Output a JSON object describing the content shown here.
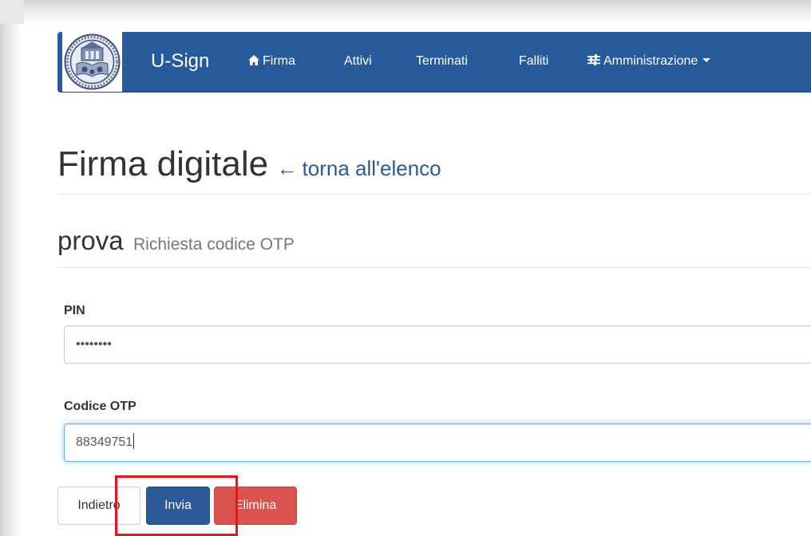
{
  "navbar": {
    "brand": "U-Sign",
    "logo_icon": "university-seal-icon",
    "items": [
      {
        "label": "Firma",
        "icon": "home-icon"
      },
      {
        "label": "Attivi"
      },
      {
        "label": "Terminati"
      },
      {
        "label": "Falliti"
      },
      {
        "label": "Amministrazione",
        "icon": "sliders-icon",
        "dropdown": true
      }
    ],
    "bg_color": "#265a9a"
  },
  "page": {
    "title": "Firma digitale",
    "back_arrow": "←",
    "back_link": "torna all'elenco"
  },
  "section": {
    "title": "prova",
    "subtitle": "Richiesta codice OTP"
  },
  "form": {
    "pin_label": "PIN",
    "pin_value": "••••••••",
    "otp_label": "Codice OTP",
    "otp_value": "88349751"
  },
  "buttons": {
    "back": "Indietro",
    "submit": "Invia",
    "delete": "Elimina"
  },
  "colors": {
    "primary": "#2b5a97",
    "danger": "#d9534f",
    "highlight": "#e8141b"
  }
}
